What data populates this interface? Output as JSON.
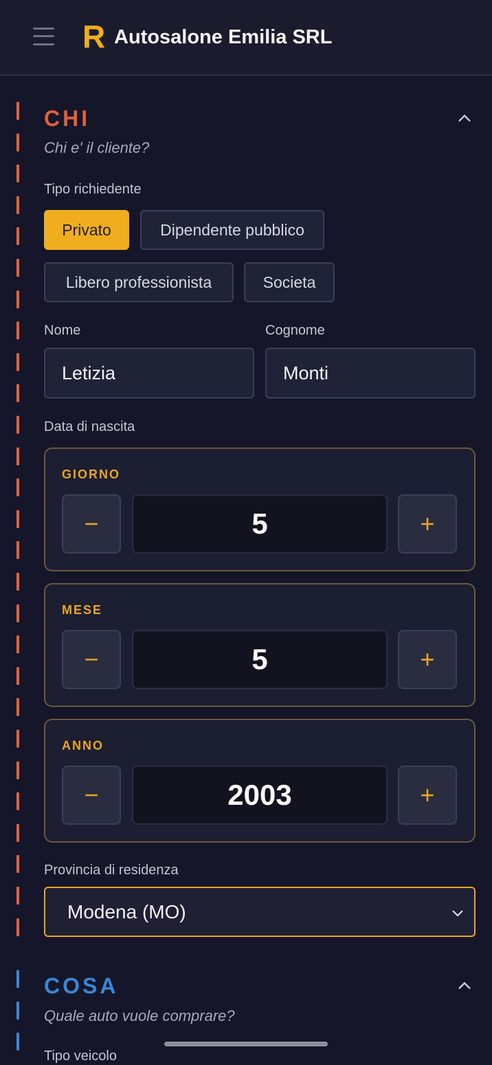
{
  "header": {
    "logo": "R",
    "title": "Autosalone Emilia SRL"
  },
  "sections": {
    "chi": {
      "title": "CHI",
      "subtitle": "Chi e' il cliente?",
      "tipo_label": "Tipo richiedente",
      "tipo_options": [
        "Privato",
        "Dipendente pubblico",
        "Libero professionista",
        "Societa"
      ],
      "tipo_selected": "Privato",
      "nome_label": "Nome",
      "nome_value": "Letizia",
      "cognome_label": "Cognome",
      "cognome_value": "Monti",
      "data_label": "Data di nascita",
      "giorno_label": "GIORNO",
      "giorno_value": "5",
      "mese_label": "MESE",
      "mese_value": "5",
      "anno_label": "ANNO",
      "anno_value": "2003",
      "provincia_label": "Provincia di residenza",
      "provincia_value": "Modena (MO)"
    },
    "cosa": {
      "title": "COSA",
      "subtitle": "Quale auto vuole comprare?",
      "tipo_veicolo_label": "Tipo veicolo"
    }
  },
  "stepper": {
    "minus": "−",
    "plus": "+"
  },
  "colors": {
    "accent": "#f0ad1e",
    "chi": "#e0623a",
    "cosa": "#3a86d8",
    "background": "#151629"
  },
  "icons": {
    "menu": "hamburger-icon",
    "collapse": "chevron-up-icon",
    "select": "chevron-down-icon"
  }
}
